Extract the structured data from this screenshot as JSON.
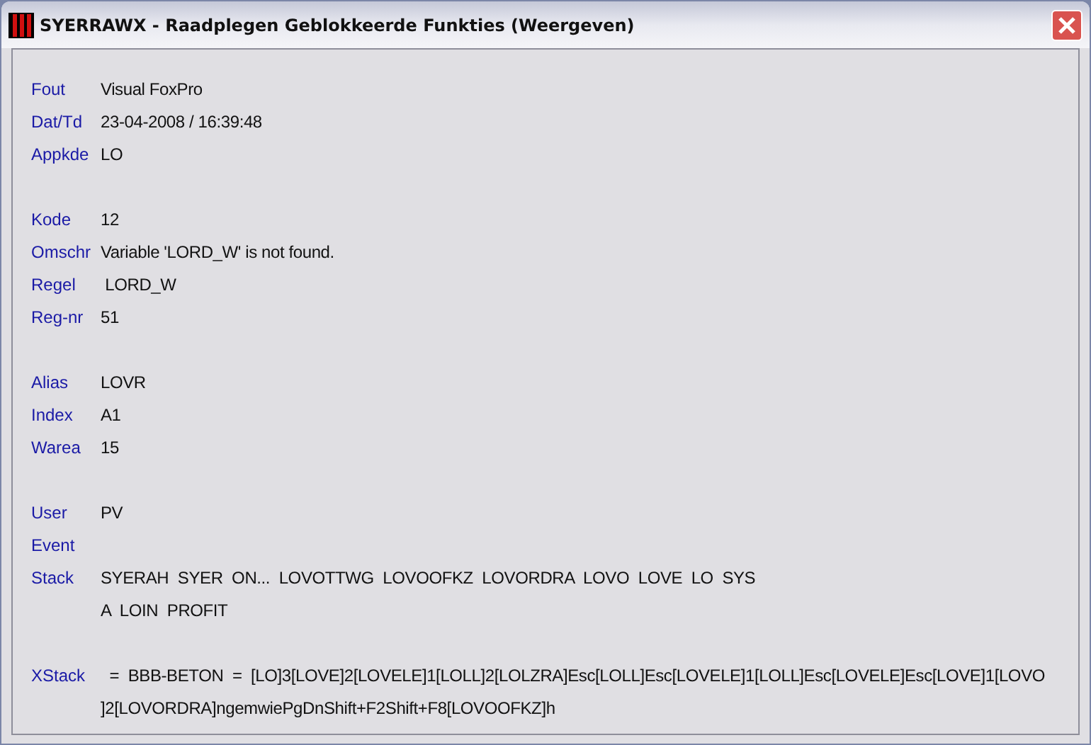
{
  "window": {
    "title": "SYERRAWX - Raadplegen Geblokkeerde Funkties (Weergeven)"
  },
  "groups": [
    {
      "fields": [
        {
          "label": "Fout",
          "lines": [
            "Visual FoxPro"
          ]
        },
        {
          "label": "Dat/Td",
          "lines": [
            "23-04-2008 / 16:39:48"
          ]
        },
        {
          "label": "Appkde",
          "lines": [
            "LO"
          ]
        }
      ]
    },
    {
      "fields": [
        {
          "label": "Kode",
          "lines": [
            "12"
          ]
        },
        {
          "label": "Omschr",
          "lines": [
            "Variable 'LORD_W' is not found."
          ]
        },
        {
          "label": "Regel",
          "lines": [
            " LORD_W"
          ]
        },
        {
          "label": "Reg-nr",
          "lines": [
            "51"
          ]
        }
      ]
    },
    {
      "fields": [
        {
          "label": "Alias",
          "lines": [
            "LOVR"
          ]
        },
        {
          "label": "Index",
          "lines": [
            "A1"
          ]
        },
        {
          "label": "Warea",
          "lines": [
            "15"
          ]
        }
      ]
    },
    {
      "fields": [
        {
          "label": "User",
          "lines": [
            "PV"
          ]
        },
        {
          "label": "Event"
        },
        {
          "label": "Stack",
          "lines": [
            "SYERAH  SYER  ON...  LOVOTTWG  LOVOOFKZ  LOVORDRA  LOVO  LOVE  LO  SYS",
            "A  LOIN  PROFIT"
          ]
        }
      ]
    },
    {
      "fields": [
        {
          "label": "XStack",
          "lines": [
            "  =  BBB-BETON  =  [LO]3[LOVE]2[LOVELE]1[LOLL]2[LOLZRA]Esc[LOLL]Esc[LOVELE]1[LOLL]Esc[LOVELE]Esc[LOVE]1[LOVO",
            "]2[LOVORDRA]ngemwiePgDnShift+F2Shift+F8[LOVOOFKZ]h"
          ]
        }
      ]
    }
  ]
}
